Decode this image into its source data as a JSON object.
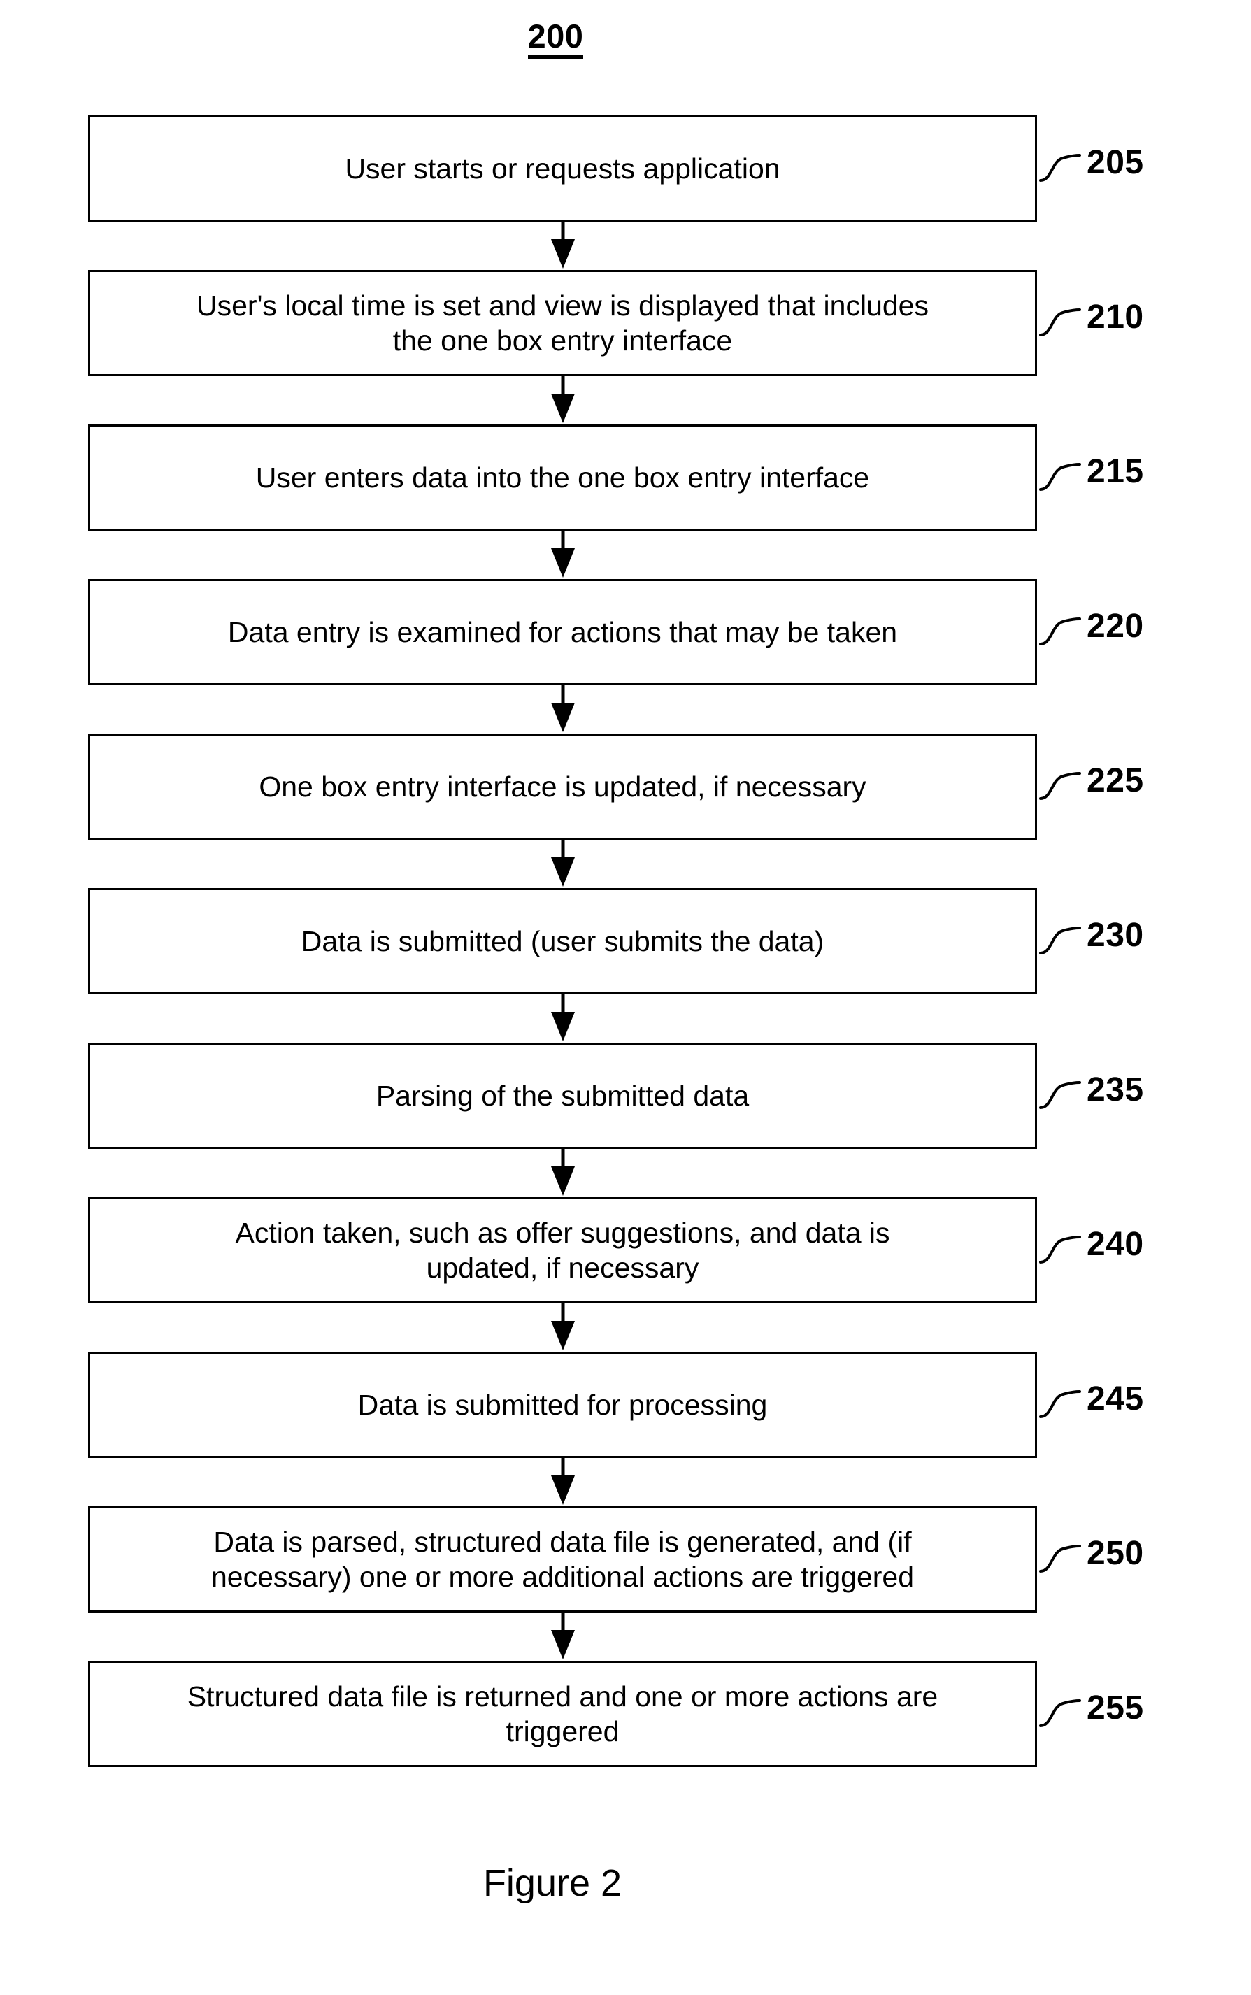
{
  "figure": {
    "id_label": "200",
    "caption": "Figure 2"
  },
  "flowchart": {
    "type": "flowchart",
    "orientation": "vertical",
    "steps": [
      {
        "ref": "205",
        "text": "User starts or requests application"
      },
      {
        "ref": "210",
        "text": "User's local time is set and view is displayed that includes\nthe one box entry interface"
      },
      {
        "ref": "215",
        "text": "User enters data into the one box entry interface"
      },
      {
        "ref": "220",
        "text": "Data entry is examined for actions that may be taken"
      },
      {
        "ref": "225",
        "text": "One box entry interface is updated, if necessary"
      },
      {
        "ref": "230",
        "text": "Data is submitted (user submits the data)"
      },
      {
        "ref": "235",
        "text": "Parsing of the submitted data"
      },
      {
        "ref": "240",
        "text": "Action taken, such as offer suggestions, and data is\nupdated, if necessary"
      },
      {
        "ref": "245",
        "text": "Data is submitted for processing"
      },
      {
        "ref": "250",
        "text": "Data is parsed, structured data file is generated, and (if\nnecessary) one or more additional actions are triggered"
      },
      {
        "ref": "255",
        "text": "Structured data file is returned and one or more actions are\ntriggered"
      }
    ]
  }
}
